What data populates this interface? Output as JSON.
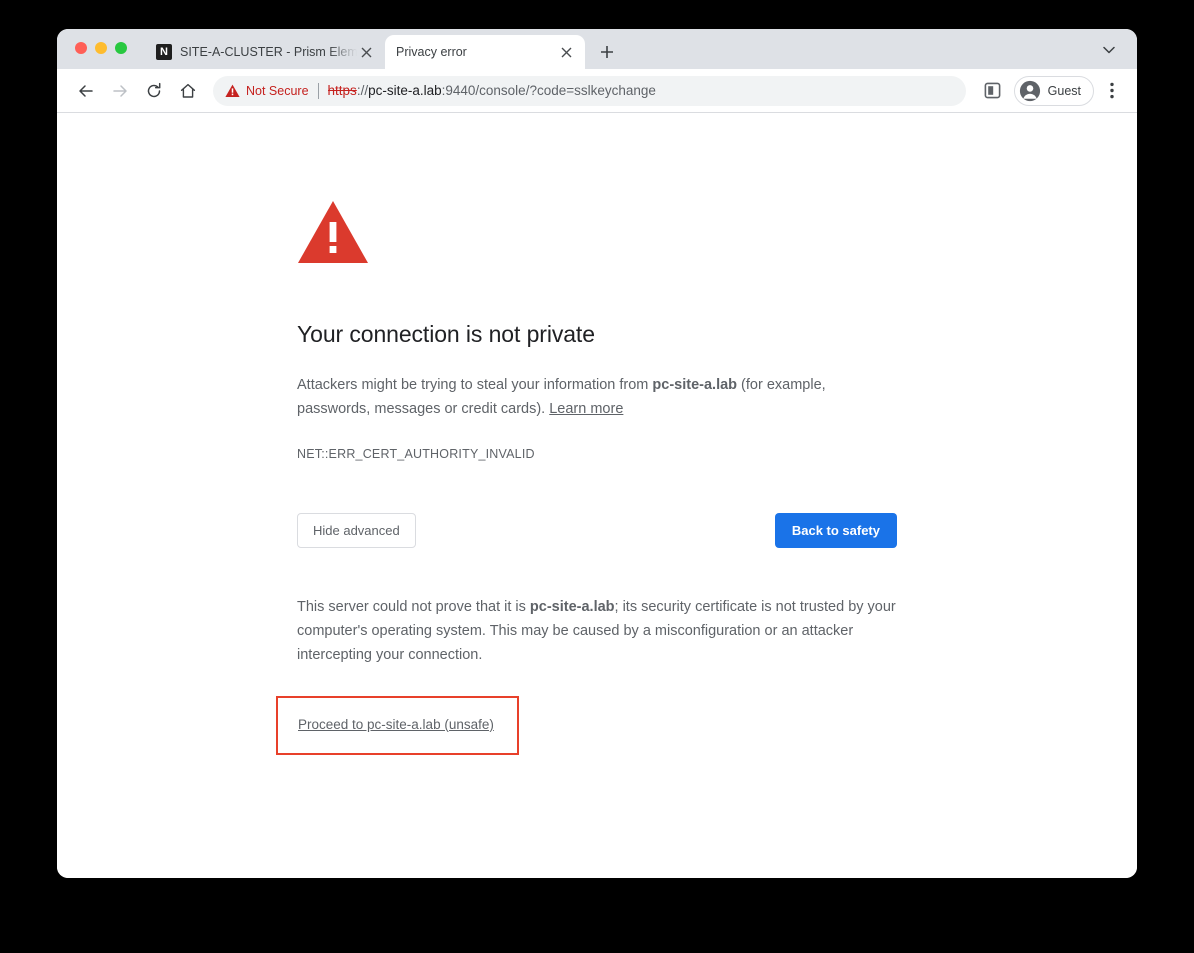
{
  "window": {
    "traffic_lights": [
      "close",
      "minimize",
      "maximize"
    ]
  },
  "tabs": [
    {
      "title": "SITE-A-CLUSTER - Prism Elem",
      "favicon_letter": "N",
      "active": false
    },
    {
      "title": "Privacy error",
      "favicon_letter": "",
      "active": true
    }
  ],
  "toolbar": {
    "back_icon": "back-arrow-icon",
    "forward_icon": "forward-arrow-icon",
    "reload_icon": "reload-icon",
    "home_icon": "home-icon",
    "security_label": "Not Secure",
    "url_scheme": "https",
    "url_separator": "://",
    "url_host": "pc-site-a.lab",
    "url_path": ":9440/console/?code=sslkeychange",
    "url_full": "https://pc-site-a.lab:9440/console/?code=sslkeychange",
    "profile_name": "Guest",
    "side_panel_icon": "side-panel-icon",
    "menu_icon": "three-dot-menu-icon"
  },
  "interstitial": {
    "icon": "red-warning-triangle-icon",
    "heading": "Your connection is not private",
    "paragraph_lead": "Attackers might be trying to steal your information from ",
    "paragraph_host": "pc-site-a.lab",
    "paragraph_tail": " (for example, passwords, messages or credit cards). ",
    "learn_more_label": "Learn more",
    "error_code": "NET::ERR_CERT_AUTHORITY_INVALID",
    "hide_advanced_label": "Hide advanced",
    "back_to_safety_label": "Back to safety",
    "advanced_lead": "This server could not prove that it is ",
    "advanced_host": "pc-site-a.lab",
    "advanced_tail": "; its security certificate is not trusted by your computer's operating system. This may be caused by a misconfiguration or an attacker intercepting your connection.",
    "proceed_label": "Proceed to pc-site-a.lab (unsafe)"
  },
  "colors": {
    "warning_red": "#db3a2d",
    "not_secure_red": "#c5221f",
    "primary_blue": "#1a73e8",
    "annotation_red": "#e8402a",
    "tabstrip_gray": "#dee1e6",
    "omnibox_gray": "#f1f3f4"
  }
}
